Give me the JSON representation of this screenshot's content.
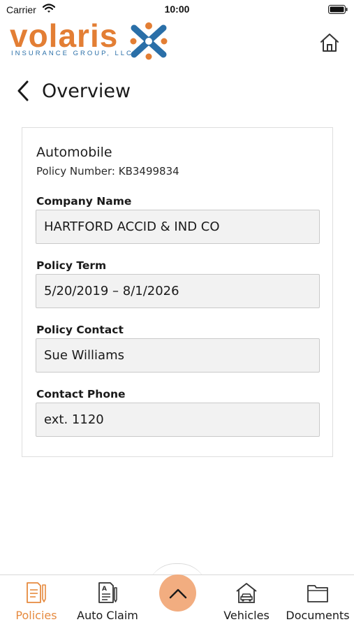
{
  "status_bar": {
    "carrier": "Carrier",
    "time": "10:00"
  },
  "header": {
    "logo_text": "volaris",
    "logo_subtext": "INSURANCE GROUP, LLC.",
    "home_icon": "home-icon"
  },
  "page": {
    "title": "Overview",
    "back_icon": "chevron-left-icon"
  },
  "policy": {
    "type": "Automobile",
    "number_text": "Policy Number: KB3499834",
    "fields": [
      {
        "label": "Company Name",
        "value": "HARTFORD ACCID & IND CO"
      },
      {
        "label": "Policy Term",
        "value": "5/20/2019 – 8/1/2026"
      },
      {
        "label": "Policy Contact",
        "value": "Sue Williams"
      },
      {
        "label": "Contact Phone",
        "value": "ext. 1120"
      }
    ]
  },
  "tab_bar": {
    "tabs": [
      {
        "label": "Policies",
        "icon": "policies-icon",
        "active": true
      },
      {
        "label": "Auto Claim",
        "icon": "auto-claim-icon",
        "active": false
      },
      {
        "label": "Vehicles",
        "icon": "vehicles-icon",
        "active": false
      },
      {
        "label": "Documents",
        "icon": "documents-icon",
        "active": false
      }
    ],
    "center_icon": "chevron-up-icon"
  },
  "colors": {
    "brand_orange": "#e37e34",
    "brand_blue": "#2a6fa8",
    "active_tab": "#e68a3f",
    "center_button": "#f2ad80",
    "field_background": "#f2f2f2"
  }
}
